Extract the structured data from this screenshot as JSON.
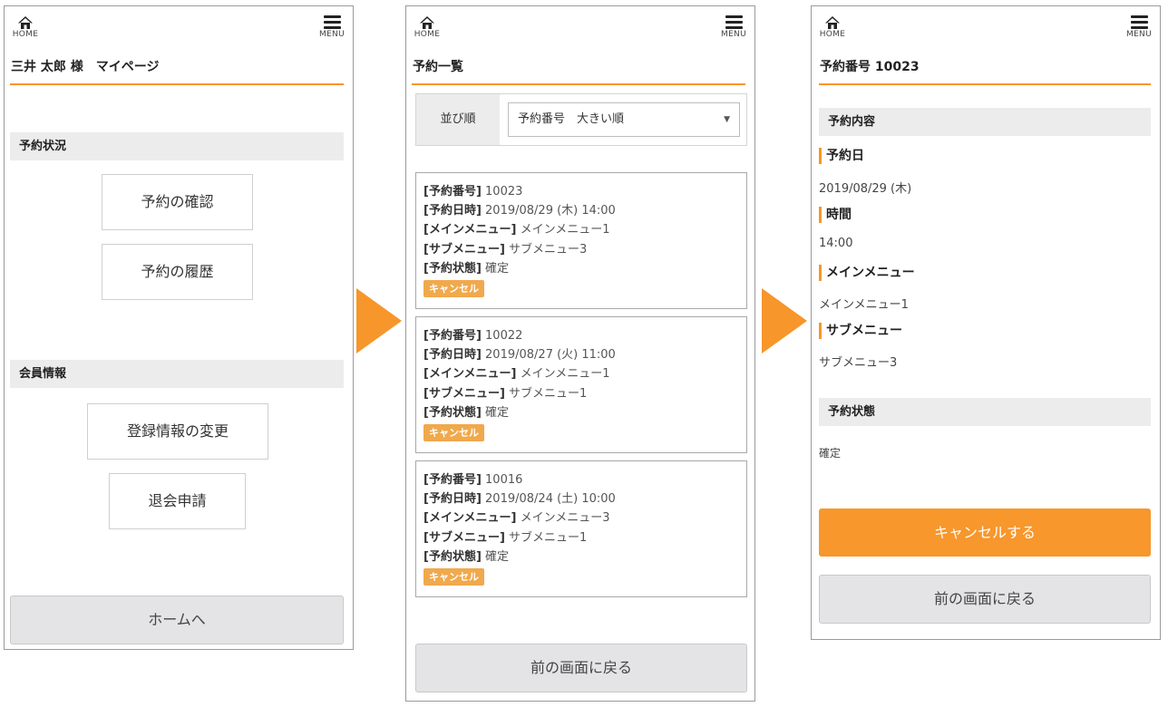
{
  "common": {
    "home_label": "HOME",
    "menu_label": "MENU",
    "accent_color": "#f7962a",
    "icons": [
      "home-icon",
      "menu-icon"
    ]
  },
  "mypage": {
    "title": "三井 太郎 様　マイページ",
    "section_reservation": "予約状況",
    "btn_confirm": "予約の確認",
    "btn_history": "予約の履歴",
    "section_member": "会員情報",
    "btn_change": "登録情報の変更",
    "btn_withdraw": "退会申請",
    "btn_home": "ホームへ"
  },
  "list": {
    "title": "予約一覧",
    "sort_label": "並び順",
    "sort_value": "予約番号　大きい順",
    "field_labels": {
      "number": "[予約番号]",
      "datetime": "[予約日時]",
      "main": "[メインメニュー]",
      "sub": "[サブメニュー]",
      "status": "[予約状態]"
    },
    "cards": [
      {
        "number": "10023",
        "datetime": "2019/08/29 (木) 14:00",
        "main": "メインメニュー1",
        "sub": "サブメニュー3",
        "status": "確定",
        "cancel": "キャンセル"
      },
      {
        "number": "10022",
        "datetime": "2019/08/27 (火) 11:00",
        "main": "メインメニュー1",
        "sub": "サブメニュー1",
        "status": "確定",
        "cancel": "キャンセル"
      },
      {
        "number": "10016",
        "datetime": "2019/08/24 (土) 10:00",
        "main": "メインメニュー3",
        "sub": "サブメニュー1",
        "status": "確定",
        "cancel": "キャンセル"
      }
    ],
    "btn_back": "前の画面に戻る"
  },
  "detail": {
    "title": "予約番号 10023",
    "section_content": "予約内容",
    "label_date": "予約日",
    "value_date": "2019/08/29 (木)",
    "label_time": "時間",
    "value_time": "14:00",
    "label_main": "メインメニュー",
    "value_main": "メインメニュー1",
    "label_sub": "サブメニュー",
    "value_sub": "サブメニュー3",
    "section_status": "予約状態",
    "value_status": "確定",
    "btn_cancel": "キャンセルする",
    "btn_back": "前の画面に戻る"
  }
}
